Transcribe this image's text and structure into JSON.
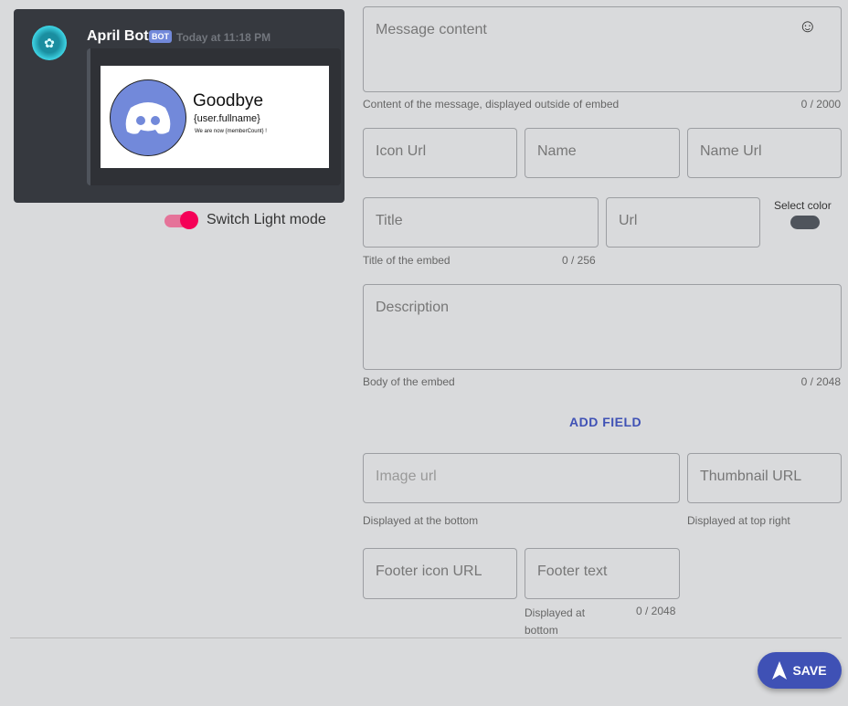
{
  "preview": {
    "bot_name": "April Bot",
    "badge": "BOT",
    "timestamp": "Today at 11:18 PM",
    "image": {
      "title": "Goodbye",
      "user": "{user.fullname}",
      "count_text": "We are now {memberCount} !"
    }
  },
  "toggle": {
    "label": "Switch Light mode",
    "on": true
  },
  "form": {
    "message": {
      "placeholder": "Message content",
      "help": "Content of the message, displayed outside of embed",
      "counter": "0 / 2000"
    },
    "icon_url": {
      "placeholder": "Icon Url"
    },
    "name": {
      "placeholder": "Name"
    },
    "name_url": {
      "placeholder": "Name Url"
    },
    "title": {
      "placeholder": "Title",
      "help": "Title of the embed",
      "counter": "0 / 256"
    },
    "url": {
      "placeholder": "Url"
    },
    "color": {
      "label": "Select color",
      "value": "#4f545c"
    },
    "description": {
      "placeholder": "Description",
      "help": "Body of the embed",
      "counter": "0 / 2048"
    },
    "add_field": "ADD FIELD",
    "image_url": {
      "placeholder": "Image url",
      "help": "Displayed at the bottom"
    },
    "thumbnail": {
      "placeholder": "Thumbnail URL",
      "help": "Displayed at top right"
    },
    "footer_icon": {
      "placeholder": "Footer icon URL"
    },
    "footer_text": {
      "placeholder": "Footer text",
      "help": "Displayed at bottom",
      "counter": "0 / 2048"
    }
  },
  "save": "SAVE"
}
